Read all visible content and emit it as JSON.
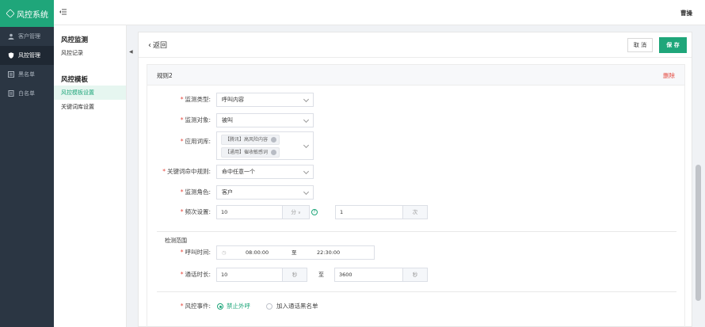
{
  "app": {
    "title": "风控系统"
  },
  "header": {
    "username": "曹操"
  },
  "sidebar": {
    "items": [
      {
        "label": "客户管理",
        "icon": "user-icon",
        "active": false
      },
      {
        "label": "风控管理",
        "icon": "shield-icon",
        "active": true
      },
      {
        "label": "黑名单",
        "icon": "list-icon",
        "active": false
      },
      {
        "label": "白名单",
        "icon": "document-icon",
        "active": false
      }
    ]
  },
  "subnav": {
    "groups": [
      {
        "title": "风控监测",
        "links": [
          {
            "label": "风控记录"
          }
        ]
      },
      {
        "title": "风控模板",
        "links": [
          {
            "label": "风控模板设置",
            "active": true
          },
          {
            "label": "关键词库设置"
          }
        ]
      }
    ]
  },
  "main": {
    "back_label": "返回",
    "cancel_label": "取 消",
    "save_label": "保 存"
  },
  "rule": {
    "title": "规则2",
    "delete_label": "删除",
    "monitor_type": {
      "label": "监测类型:",
      "value": "呼叫内容"
    },
    "monitor_target": {
      "label": "监测对象:",
      "value": "被叫"
    },
    "lexicon": {
      "label": "应用词库:",
      "tags": [
        "【腾讯】高风险内容",
        "【通用】催收敏感词"
      ]
    },
    "keyword_rule": {
      "label": "关键词命中规则:",
      "value": "命中任意一个"
    },
    "monitor_role": {
      "label": "监测角色:",
      "value": "客户"
    },
    "frequency": {
      "label": "频次设置:",
      "value": "10",
      "unit": "分",
      "count": "1",
      "count_unit": "次",
      "help": "?"
    },
    "scope_title": "检测范围",
    "call_time": {
      "label": "呼叫时间:",
      "start": "08:00:00",
      "sep": "至",
      "end": "22:30:00"
    },
    "duration": {
      "label": "通话时长:",
      "min": "10",
      "min_unit": "秒",
      "sep": "至",
      "max": "3600",
      "max_unit": "秒"
    },
    "event": {
      "label": "风控事件:",
      "options": [
        {
          "label": "禁止外呼",
          "checked": true
        },
        {
          "label": "加入通话黑名单",
          "checked": false
        }
      ]
    }
  },
  "colors": {
    "accent": "#1fa67a",
    "danger": "#e4473d",
    "sidebar": "#2b3643"
  }
}
